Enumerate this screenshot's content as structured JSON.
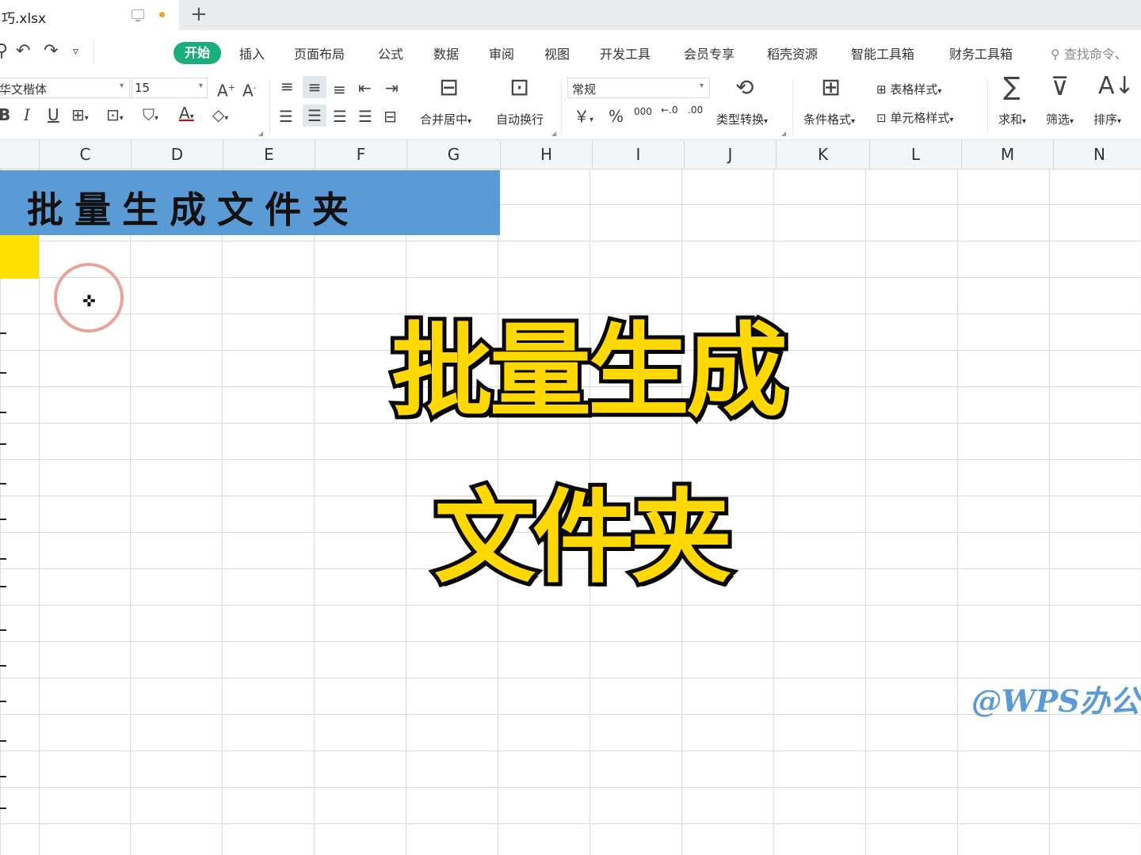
{
  "tab": {
    "filename": "巧.xlsx",
    "new_tab": "+"
  },
  "colors": {
    "accent": "#1aae7a",
    "banner": "#5b9bd5",
    "yellow": "#ffe000",
    "overlay_text": "#ffd800",
    "watermark": "#5b9bd5",
    "unsaved_dot": "#f0a020"
  },
  "quick_access": {
    "icons": [
      "search-icon",
      "undo-icon",
      "redo-icon",
      "customize-icon"
    ]
  },
  "menu": [
    "开始",
    "插入",
    "页面布局",
    "公式",
    "数据",
    "审阅",
    "视图",
    "开发工具",
    "会员专享",
    "稻壳资源",
    "智能工具箱",
    "财务工具箱"
  ],
  "search_command": "查找命令、",
  "ribbon": {
    "font_name": "华文楷体",
    "font_size": "15",
    "bold": "B",
    "italic": "I",
    "underline": "U",
    "merge_center": "合并居中",
    "auto_wrap": "自动换行",
    "number_format": "常规",
    "currency": "￥",
    "percent": "%",
    "thousands": "000",
    "decimal_add": "←.0",
    "decimal_remove": ".00",
    "type_convert": "类型转换",
    "cond_format": "条件格式",
    "table_style": "表格样式",
    "cell_style": "单元格样式",
    "sum": "求和",
    "filter": "筛选",
    "sort": "排序"
  },
  "columns": [
    "C",
    "D",
    "E",
    "F",
    "G",
    "H",
    "I",
    "J",
    "K",
    "L",
    "M",
    "N"
  ],
  "sheet": {
    "title": "批量生成文件夹"
  },
  "overlay": {
    "line1": "批量生成",
    "line2": "文件夹"
  },
  "watermark": "@WPS办公"
}
